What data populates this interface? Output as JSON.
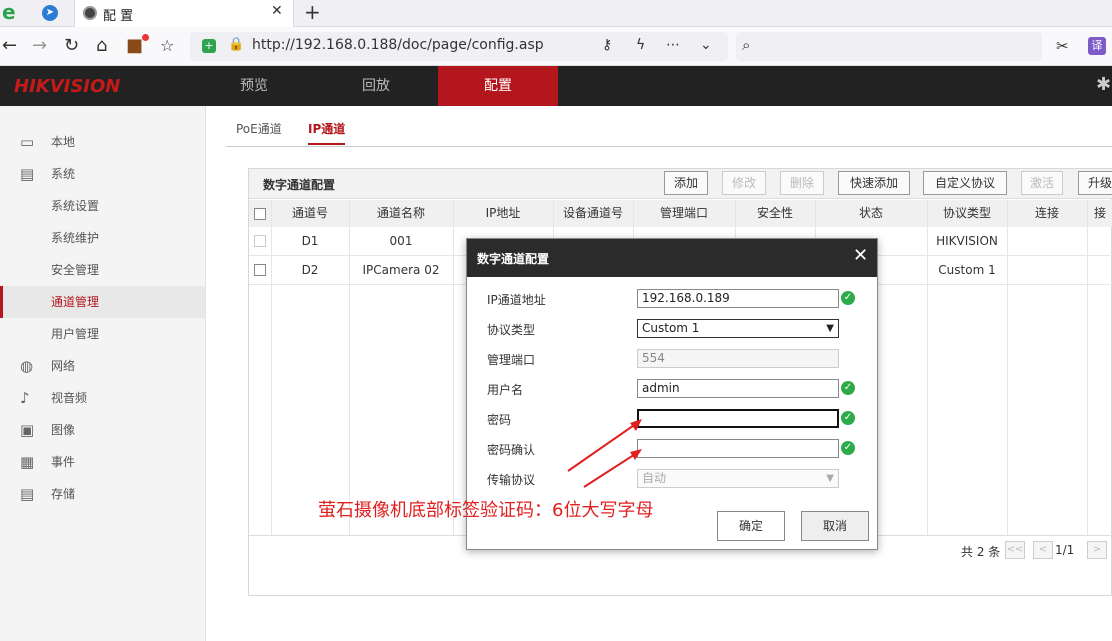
{
  "browser": {
    "tab_title": "配 置",
    "address": "http://192.168.0.188/doc/page/config.asp",
    "translate_label": "译"
  },
  "header": {
    "logo": "HIKVISION",
    "menu": [
      "预览",
      "回放",
      "配置"
    ],
    "active_menu": 2
  },
  "sidebar": {
    "items": [
      {
        "label": "本地",
        "icon": "monitor-icon",
        "sub": false
      },
      {
        "label": "系统",
        "icon": "system-icon",
        "sub": false
      },
      {
        "label": "系统设置",
        "sub": true
      },
      {
        "label": "系统维护",
        "sub": true
      },
      {
        "label": "安全管理",
        "sub": true
      },
      {
        "label": "通道管理",
        "sub": true,
        "selected": true
      },
      {
        "label": "用户管理",
        "sub": true
      },
      {
        "label": "网络",
        "icon": "globe-icon",
        "sub": false
      },
      {
        "label": "视音频",
        "icon": "mic-icon",
        "sub": false
      },
      {
        "label": "图像",
        "icon": "image-icon",
        "sub": false
      },
      {
        "label": "事件",
        "icon": "calendar-icon",
        "sub": false
      },
      {
        "label": "存储",
        "icon": "storage-icon",
        "sub": false
      }
    ]
  },
  "subtabs": [
    "PoE通道",
    "IP通道"
  ],
  "active_subtab": 1,
  "panel": {
    "title": "数字通道配置",
    "toolbar": {
      "add": "添加",
      "modify": "修改",
      "delete": "删除",
      "quick_add": "快速添加",
      "custom_protocol": "自定义协议",
      "activate": "激活",
      "upgrade": "升级"
    },
    "columns": [
      "通道号",
      "通道名称",
      "IP地址",
      "设备通道号",
      "管理端口",
      "安全性",
      "状态",
      "协议类型",
      "连接",
      "接"
    ],
    "rows": [
      {
        "cells": [
          "D1",
          "001",
          "",
          "",
          "",
          "",
          "",
          "HIKVISION",
          "",
          ""
        ]
      },
      {
        "cells": [
          "D2",
          "IPCamera 02",
          "",
          "",
          "",
          "",
          "",
          "Custom 1",
          "",
          ""
        ]
      }
    ],
    "pager": {
      "total": "共 2 条",
      "first": "<<",
      "prev": "<",
      "page": "1/1",
      "next": ">"
    }
  },
  "dialog": {
    "title": "数字通道配置",
    "close": "✕",
    "fields": {
      "ip_label": "IP通道地址",
      "ip_value": "192.168.0.189",
      "protocol_label": "协议类型",
      "protocol_value": "Custom 1",
      "port_label": "管理端口",
      "port_value": "554",
      "user_label": "用户名",
      "user_value": "admin",
      "pwd_label": "密码",
      "pwd_value": "",
      "pwd2_label": "密码确认",
      "pwd2_value": "",
      "transport_label": "传输协议",
      "transport_value": "自动"
    },
    "ok_label": "确定",
    "cancel_label": "取消"
  },
  "annotation": {
    "text": "萤石摄像机底部标签验证码：6位大写字母",
    "color": "#e02020"
  },
  "colors": {
    "accent": "#b3171d",
    "header": "#222222",
    "valid": "#2eaa4a"
  }
}
